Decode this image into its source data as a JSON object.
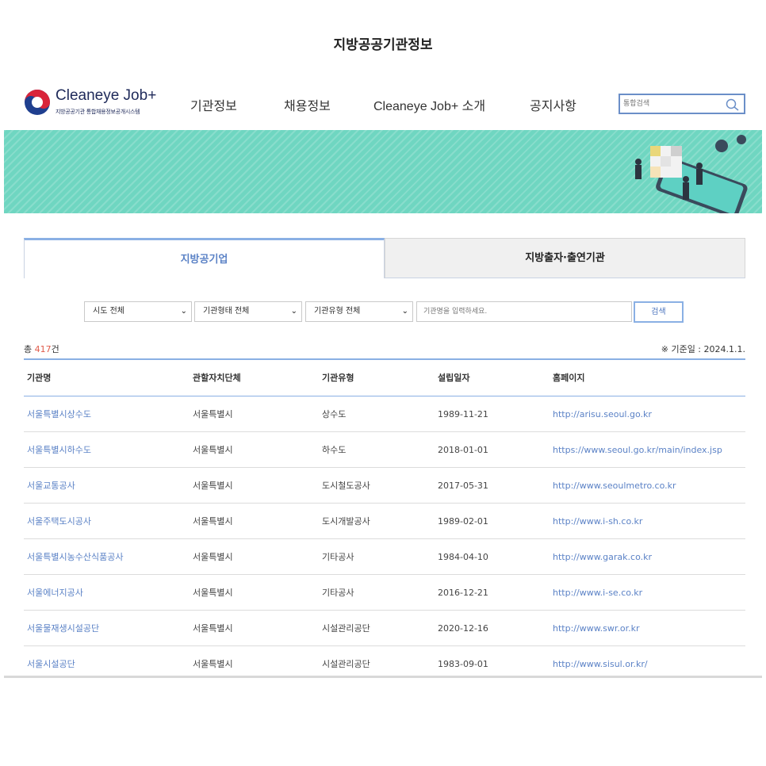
{
  "header": {
    "logo_title": "Cleaneye Job+",
    "logo_subtitle": "지방공공기관 통합채용정보공개시스템",
    "nav": [
      "기관정보",
      "채용정보",
      "Cleaneye Job+ 소개",
      "공지사항"
    ],
    "search_placeholder": "통합검색"
  },
  "banner": {
    "title": "지방공공기관정보"
  },
  "tabs": [
    {
      "label": "지방공기업",
      "active": true
    },
    {
      "label": "지방출자·출연기관",
      "active": false
    }
  ],
  "filters": {
    "region": "시도 전체",
    "org_form": "기관형태 전체",
    "org_type": "기관유형 전체",
    "keyword_placeholder": "기관명을 입력하세요.",
    "search_label": "검색"
  },
  "summary": {
    "total_prefix": "총 ",
    "total_count": "417",
    "total_suffix": "건",
    "basis_date": "※ 기준일 : 2024.1.1."
  },
  "table": {
    "headers": [
      "기관명",
      "관할자치단체",
      "기관유형",
      "설립일자",
      "홈페이지"
    ],
    "rows": [
      [
        "서울특별시상수도",
        "서울특별시",
        "상수도",
        "1989-11-21",
        "http://arisu.seoul.go.kr"
      ],
      [
        "서울특별시하수도",
        "서울특별시",
        "하수도",
        "2018-01-01",
        "https://www.seoul.go.kr/main/index.jsp"
      ],
      [
        "서울교통공사",
        "서울특별시",
        "도시철도공사",
        "2017-05-31",
        "http://www.seoulmetro.co.kr"
      ],
      [
        "서울주택도시공사",
        "서울특별시",
        "도시개발공사",
        "1989-02-01",
        "http://www.i-sh.co.kr"
      ],
      [
        "서울특별시농수산식품공사",
        "서울특별시",
        "기타공사",
        "1984-04-10",
        "http://www.garak.co.kr"
      ],
      [
        "서울에너지공사",
        "서울특별시",
        "기타공사",
        "2016-12-21",
        "http://www.i-se.co.kr"
      ],
      [
        "서울물재생시설공단",
        "서울특별시",
        "시설관리공단",
        "2020-12-16",
        "http://www.swr.or.kr"
      ],
      [
        "서울시설공단",
        "서울특별시",
        "시설관리공단",
        "1983-09-01",
        "http://www.sisul.or.kr/"
      ]
    ]
  },
  "colors": {
    "banner_bg": "#6fd6c1",
    "accent_blue": "#5b82c6",
    "count_red": "#e05c4b"
  }
}
